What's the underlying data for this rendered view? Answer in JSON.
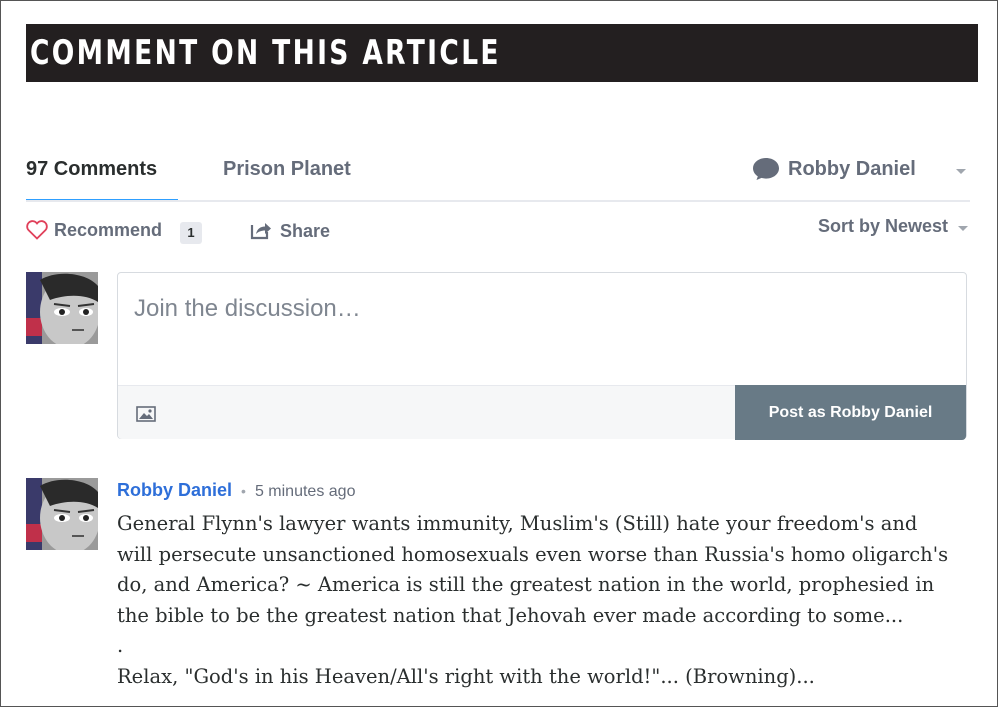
{
  "banner": {
    "title": "COMMENT ON THIS ARTICLE"
  },
  "nav": {
    "comments_tab": "97 Comments",
    "community_tab": "Prison Planet",
    "user_name": "Robby Daniel"
  },
  "actions": {
    "recommend_label": "Recommend",
    "recommend_count": "1",
    "share_label": "Share",
    "sort_label": "Sort by Newest"
  },
  "composer": {
    "placeholder": "Join the discussion…",
    "post_button": "Post as Robby Daniel"
  },
  "comment": {
    "author": "Robby Daniel",
    "separator": "•",
    "time": "5 minutes ago",
    "lines": [
      "General Flynn's lawyer wants immunity, Muslim's (Still) hate your freedom's and",
      "will persecute unsanctioned homosexuals even worse than Russia's homo oligarch's",
      "do, and America? ~ America is still the greatest nation in the world, prophesied in",
      "the bible to be the greatest nation that Jehovah ever made according to some...",
      ".",
      "Relax, \"God's in his Heaven/All's right with the world!\"... (Browning)..."
    ]
  },
  "colors": {
    "accent_blue": "#2e9fff",
    "author_link": "#2e6fd9",
    "heart": "#e0405a",
    "post_button": "#687a86"
  },
  "icons": [
    "speech-bubble-icon",
    "heart-icon",
    "share-icon",
    "image-icon",
    "chevron-down-icon"
  ]
}
